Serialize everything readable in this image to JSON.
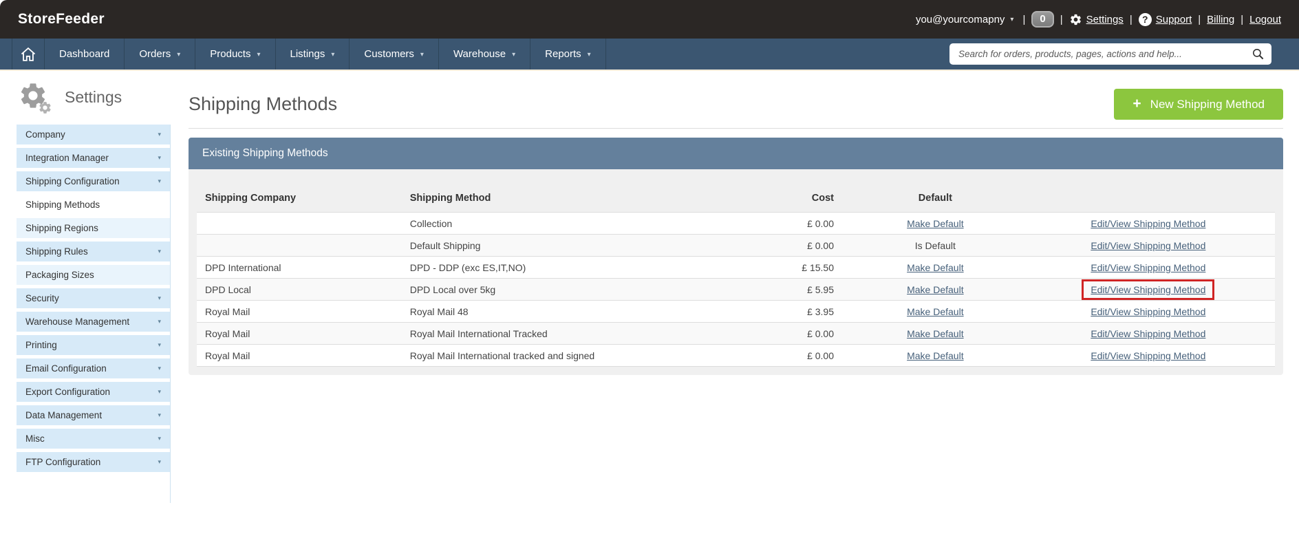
{
  "topbar": {
    "brand": "StoreFeeder",
    "user": "you@yourcomapny",
    "badge_count": "0",
    "separator": "|",
    "links": {
      "settings": "Settings",
      "support": "Support",
      "billing": "Billing",
      "logout": "Logout"
    }
  },
  "nav": {
    "items": [
      {
        "label": "Dashboard",
        "has_caret": false
      },
      {
        "label": "Orders",
        "has_caret": true
      },
      {
        "label": "Products",
        "has_caret": true
      },
      {
        "label": "Listings",
        "has_caret": true
      },
      {
        "label": "Customers",
        "has_caret": true
      },
      {
        "label": "Warehouse",
        "has_caret": true
      },
      {
        "label": "Reports",
        "has_caret": true
      }
    ],
    "search_placeholder": "Search for orders, products, pages, actions and help..."
  },
  "sidebar": {
    "title": "Settings",
    "items": [
      {
        "label": "Company",
        "caret": true,
        "state": "parent"
      },
      {
        "label": "Integration Manager",
        "caret": true,
        "state": "parent"
      },
      {
        "label": "Shipping Configuration",
        "caret": true,
        "state": "parent"
      },
      {
        "label": "Shipping Methods",
        "caret": false,
        "state": "active"
      },
      {
        "label": "Shipping Regions",
        "caret": false,
        "state": "leaf"
      },
      {
        "label": "Shipping Rules",
        "caret": true,
        "state": "parent"
      },
      {
        "label": "Packaging Sizes",
        "caret": false,
        "state": "leaf"
      },
      {
        "label": "Security",
        "caret": true,
        "state": "parent"
      },
      {
        "label": "Warehouse Management",
        "caret": true,
        "state": "parent"
      },
      {
        "label": "Printing",
        "caret": true,
        "state": "parent"
      },
      {
        "label": "Email Configuration",
        "caret": true,
        "state": "parent"
      },
      {
        "label": "Export Configuration",
        "caret": true,
        "state": "parent"
      },
      {
        "label": "Data Management",
        "caret": true,
        "state": "parent"
      },
      {
        "label": "Misc",
        "caret": true,
        "state": "parent"
      },
      {
        "label": "FTP Configuration",
        "caret": true,
        "state": "parent"
      }
    ]
  },
  "main": {
    "title": "Shipping Methods",
    "new_button": "New Shipping Method",
    "panel_title": "Existing Shipping Methods",
    "table": {
      "headers": [
        "Shipping Company",
        "Shipping Method",
        "Cost",
        "Default",
        ""
      ],
      "rows": [
        {
          "company": "",
          "method": "Collection",
          "cost": "£ 0.00",
          "default": "Make Default",
          "default_is_link": true,
          "action": "Edit/View Shipping Method",
          "highlight": false
        },
        {
          "company": "",
          "method": "Default Shipping",
          "cost": "£ 0.00",
          "default": "Is Default",
          "default_is_link": false,
          "action": "Edit/View Shipping Method",
          "highlight": false
        },
        {
          "company": "DPD International",
          "method": "DPD - DDP (exc ES,IT,NO)",
          "cost": "£ 15.50",
          "default": "Make Default",
          "default_is_link": true,
          "action": "Edit/View Shipping Method",
          "highlight": false
        },
        {
          "company": "DPD Local",
          "method": "DPD Local over 5kg",
          "cost": "£ 5.95",
          "default": "Make Default",
          "default_is_link": true,
          "action": "Edit/View Shipping Method",
          "highlight": true
        },
        {
          "company": "Royal Mail",
          "method": "Royal Mail 48",
          "cost": "£ 3.95",
          "default": "Make Default",
          "default_is_link": true,
          "action": "Edit/View Shipping Method",
          "highlight": false
        },
        {
          "company": "Royal Mail",
          "method": "Royal Mail International Tracked",
          "cost": "£ 0.00",
          "default": "Make Default",
          "default_is_link": true,
          "action": "Edit/View Shipping Method",
          "highlight": false
        },
        {
          "company": "Royal Mail",
          "method": "Royal Mail International tracked and signed",
          "cost": "£ 0.00",
          "default": "Make Default",
          "default_is_link": true,
          "action": "Edit/View Shipping Method",
          "highlight": false
        }
      ]
    }
  },
  "colors": {
    "accent_green": "#8cc63e",
    "panel_header": "#64809c",
    "nav": "#3b5671",
    "topbar": "#2b2725",
    "highlight_red": "#d02424",
    "sidebar_parent": "#d7eaf8",
    "sidebar_leaf": "#e9f4fc",
    "link": "#46607a"
  }
}
